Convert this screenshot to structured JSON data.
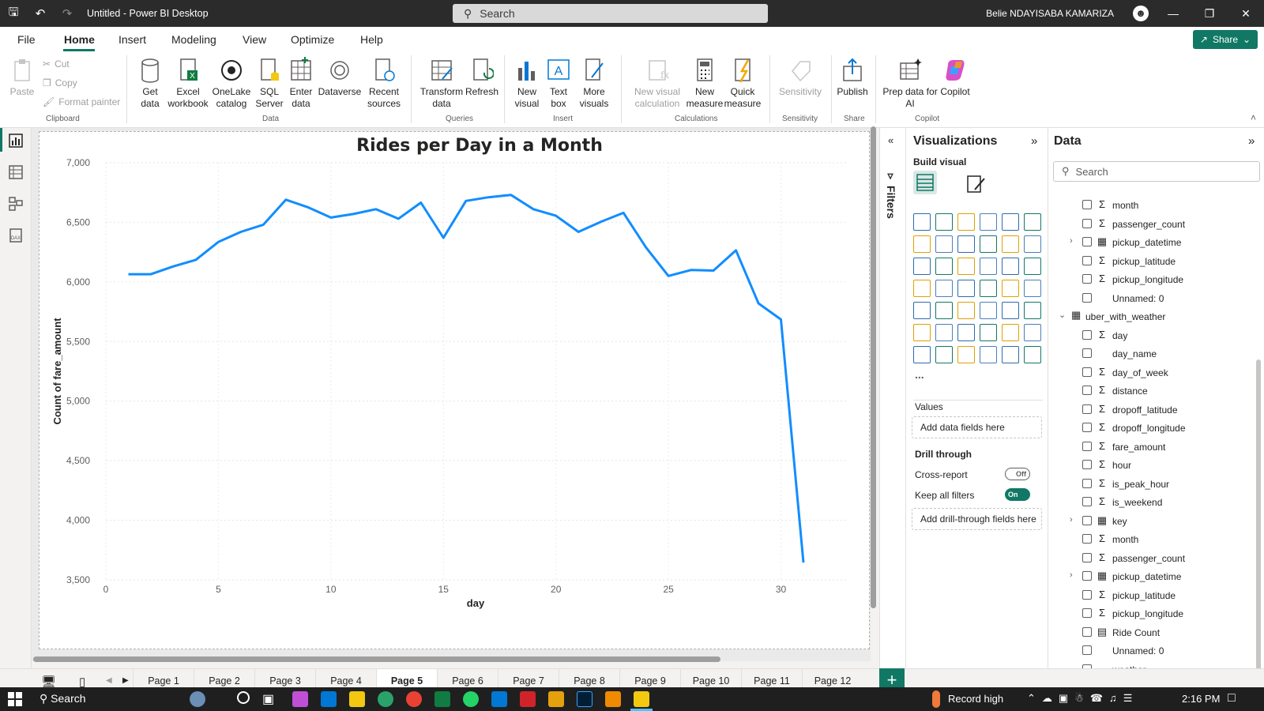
{
  "window": {
    "title": "Untitled - Power BI Desktop",
    "search_placeholder": "Search",
    "user": "Belie NDAYISABA KAMARIZA"
  },
  "menu": {
    "items": [
      "File",
      "Home",
      "Insert",
      "Modeling",
      "View",
      "Optimize",
      "Help"
    ],
    "active": "Home",
    "share_label": "Share"
  },
  "ribbon": {
    "clipboard": {
      "paste": "Paste",
      "cut": "Cut",
      "copy": "Copy",
      "format_painter": "Format painter",
      "group": "Clipboard"
    },
    "data": {
      "get_data": [
        "Get",
        "data"
      ],
      "excel": [
        "Excel",
        "workbook"
      ],
      "onelake": [
        "OneLake",
        "catalog"
      ],
      "sql": [
        "SQL",
        "Server"
      ],
      "enter": [
        "Enter",
        "data"
      ],
      "dataverse": "Dataverse",
      "recent": [
        "Recent",
        "sources"
      ],
      "group": "Data"
    },
    "queries": {
      "transform": [
        "Transform",
        "data"
      ],
      "refresh": "Refresh",
      "group": "Queries"
    },
    "insert": {
      "new_visual": [
        "New",
        "visual"
      ],
      "text_box": [
        "Text",
        "box"
      ],
      "more_visuals": [
        "More",
        "visuals"
      ],
      "group": "Insert"
    },
    "calculations": {
      "new_visual_calc": [
        "New visual",
        "calculation"
      ],
      "new_measure": [
        "New",
        "measure"
      ],
      "quick_measure": [
        "Quick",
        "measure"
      ],
      "group": "Calculations"
    },
    "sensitivity": {
      "label": "Sensitivity",
      "group": "Sensitivity"
    },
    "share": {
      "publish": "Publish",
      "group": "Share"
    },
    "copilot": {
      "prep": [
        "Prep data for",
        "AI"
      ],
      "copilot": "Copilot",
      "group": "Copilot"
    }
  },
  "chart_data": {
    "type": "line",
    "title": "Rides per Day in a Month",
    "xlabel": "day",
    "ylabel": "Count of fare_amount",
    "xlim": [
      0,
      33
    ],
    "ylim": [
      3500,
      7000
    ],
    "x_ticks": [
      "0",
      "5",
      "10",
      "15",
      "20",
      "25",
      "30"
    ],
    "y_ticks": [
      "3,500",
      "4,000",
      "4,500",
      "5,000",
      "5,500",
      "6,000",
      "6,500",
      "7,000"
    ],
    "color": "#118dff",
    "x": [
      1,
      2,
      3,
      4,
      5,
      6,
      7,
      8,
      9,
      10,
      11,
      12,
      13,
      14,
      15,
      16,
      17,
      18,
      19,
      20,
      21,
      22,
      23,
      24,
      25,
      26,
      27,
      28,
      29,
      30,
      31
    ],
    "values": [
      6065,
      6065,
      6130,
      6185,
      6335,
      6420,
      6480,
      6690,
      6625,
      6540,
      6570,
      6610,
      6530,
      6665,
      6370,
      6680,
      6710,
      6730,
      6610,
      6555,
      6420,
      6505,
      6580,
      6290,
      6050,
      6100,
      6095,
      6265,
      5820,
      5685,
      3645
    ]
  },
  "filters": {
    "label": "Filters"
  },
  "visualizations": {
    "title": "Visualizations",
    "build_visual": "Build visual",
    "values_label": "Values",
    "add_fields": "Add data fields here",
    "drill_through": "Drill through",
    "cross_report": "Cross-report",
    "cross_report_state": "Off",
    "keep_filters": "Keep all filters",
    "keep_filters_state": "On",
    "add_drill": "Add drill-through fields here",
    "more": "..."
  },
  "data_pane": {
    "title": "Data",
    "search_placeholder": "Search",
    "fields_top": [
      {
        "name": "month",
        "type": "sigma"
      },
      {
        "name": "passenger_count",
        "type": "sigma"
      },
      {
        "name": "pickup_datetime",
        "type": "calendar",
        "expandable": true
      },
      {
        "name": "pickup_latitude",
        "type": "sigma"
      },
      {
        "name": "pickup_longitude",
        "type": "sigma"
      },
      {
        "name": "Unnamed: 0",
        "type": "none"
      }
    ],
    "table_name": "uber_with_weather",
    "fields": [
      {
        "name": "day",
        "type": "sigma"
      },
      {
        "name": "day_name",
        "type": "none"
      },
      {
        "name": "day_of_week",
        "type": "sigma"
      },
      {
        "name": "distance",
        "type": "sigma"
      },
      {
        "name": "dropoff_latitude",
        "type": "sigma"
      },
      {
        "name": "dropoff_longitude",
        "type": "sigma"
      },
      {
        "name": "fare_amount",
        "type": "sigma"
      },
      {
        "name": "hour",
        "type": "sigma"
      },
      {
        "name": "is_peak_hour",
        "type": "sigma"
      },
      {
        "name": "is_weekend",
        "type": "sigma"
      },
      {
        "name": "key",
        "type": "calendar",
        "expandable": true
      },
      {
        "name": "month",
        "type": "sigma"
      },
      {
        "name": "passenger_count",
        "type": "sigma"
      },
      {
        "name": "pickup_datetime",
        "type": "calendar",
        "expandable": true
      },
      {
        "name": "pickup_latitude",
        "type": "sigma"
      },
      {
        "name": "pickup_longitude",
        "type": "sigma"
      },
      {
        "name": "Ride Count",
        "type": "calc"
      },
      {
        "name": "Unnamed: 0",
        "type": "none"
      },
      {
        "name": "weather",
        "type": "none"
      }
    ]
  },
  "pages": {
    "tabs": [
      "Page 1",
      "Page 2",
      "Page 3",
      "Page 4",
      "Page 5",
      "Page 6",
      "Page 7",
      "Page 8",
      "Page 9",
      "Page 10",
      "Page 11",
      "Page 12"
    ],
    "active": "Page 5"
  },
  "taskbar": {
    "search_label": "Search",
    "weather_label": "Record high",
    "time": "2:16 PM"
  }
}
